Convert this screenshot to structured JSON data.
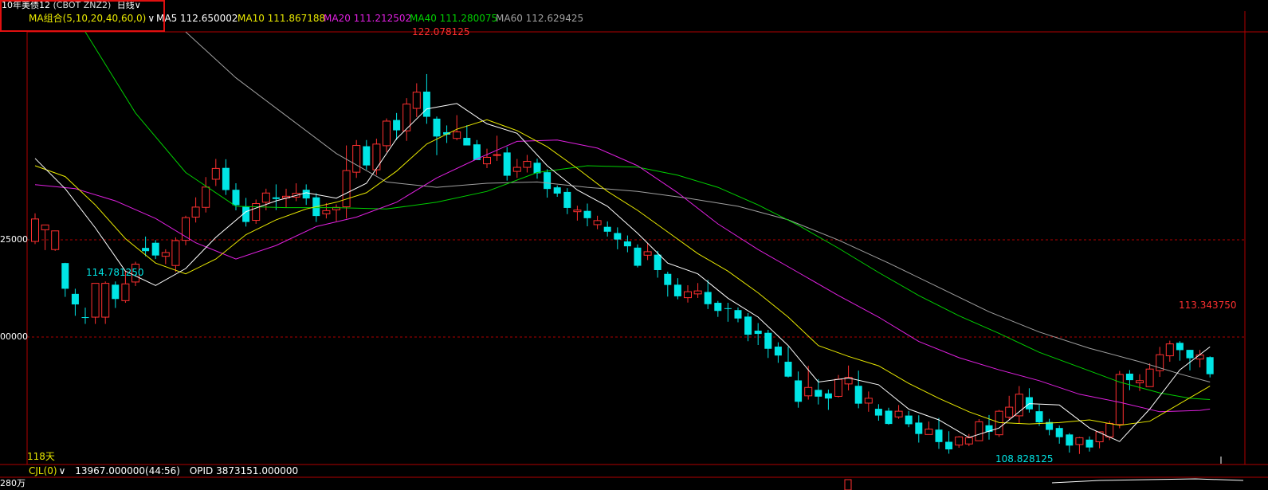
{
  "header": {
    "instrument": "10年美债12",
    "code": "(CBOT ZNZ2)",
    "period": "日线",
    "period_arrow": "∨"
  },
  "ma_bar": {
    "combo_label": "MA组合(5,10,20,40,60,0)",
    "combo_arrow": "∨",
    "items": [
      {
        "label": "MA5 112.650002",
        "color": "#ffffff"
      },
      {
        "label": "MA10 111.867188",
        "color": "#e8e800"
      },
      {
        "label": "MA20 111.212502",
        "color": "#e020e0"
      },
      {
        "label": "MA40 111.280075",
        "color": "#00d000"
      },
      {
        "label": "MA60 112.629425",
        "color": "#a0a0a0"
      }
    ]
  },
  "annotations": {
    "high": "122.078125",
    "low": "114.781250",
    "low2": "108.828125",
    "recent_high": "113.343750",
    "days": "118天"
  },
  "axis": {
    "tick_upper": "25000",
    "tick_lower": "00000",
    "vol_tick": "280万"
  },
  "volume_bar": {
    "label": "CJL(0)",
    "arrow": "∨",
    "value": "13967.000000(44:56)",
    "opid": "OPID 3873151.000000"
  },
  "colors": {
    "up": "#ff3030",
    "down": "#00e5e5",
    "grid": "#b00000",
    "ma5": "#ffffff",
    "ma10": "#e8e800",
    "ma20": "#e020e0",
    "ma40": "#00d000",
    "ma60": "#a0a0a0"
  },
  "chart_data": {
    "type": "candlestick",
    "ylim": [
      107.5,
      123.5
    ],
    "gridlines": [
      117.25,
      114.0
    ],
    "candles": [
      [
        115.75,
        116.58,
        116.79,
        115.65
      ],
      [
        116.18,
        116.36,
        116.37,
        115.43
      ],
      [
        115.45,
        116.14,
        116.15,
        115.4
      ],
      [
        114.95,
        114.0,
        114.96,
        113.7
      ],
      [
        113.81,
        113.42,
        114.0,
        113.0
      ],
      [
        112.95,
        112.92,
        113.3,
        112.7
      ],
      [
        112.95,
        114.2,
        114.2,
        112.7
      ],
      [
        112.95,
        114.2,
        114.27,
        112.7
      ],
      [
        114.15,
        113.62,
        114.27,
        113.29
      ],
      [
        113.56,
        114.18,
        114.64,
        113.48
      ],
      [
        114.25,
        114.91,
        115.0,
        114.1
      ],
      [
        115.51,
        115.39,
        115.93,
        115.2
      ],
      [
        115.7,
        115.23,
        115.8,
        115.1
      ],
      [
        115.2,
        115.34,
        115.46,
        114.91
      ],
      [
        114.86,
        115.78,
        115.9,
        114.62
      ],
      [
        115.79,
        116.63,
        116.7,
        115.61
      ],
      [
        116.65,
        117.02,
        117.38,
        116.45
      ],
      [
        117.01,
        117.76,
        118.13,
        116.82
      ],
      [
        118.05,
        118.45,
        118.8,
        117.8
      ],
      [
        118.47,
        117.65,
        118.79,
        117.47
      ],
      [
        117.66,
        117.09,
        117.9,
        116.9
      ],
      [
        117.04,
        116.47,
        117.36,
        116.3
      ],
      [
        116.53,
        117.15,
        117.3,
        116.4
      ],
      [
        117.2,
        117.54,
        117.7,
        116.9
      ],
      [
        117.38,
        117.32,
        117.86,
        116.91
      ],
      [
        117.36,
        117.42,
        117.7,
        117.0
      ],
      [
        117.39,
        117.53,
        117.9,
        117.24
      ],
      [
        117.66,
        117.34,
        117.86,
        117.1
      ],
      [
        117.38,
        116.69,
        117.53,
        116.47
      ],
      [
        116.77,
        116.89,
        117.17,
        116.6
      ],
      [
        116.92,
        117.01,
        117.12,
        116.5
      ],
      [
        117.03,
        118.37,
        119.3,
        116.6
      ],
      [
        118.31,
        119.3,
        119.5,
        118.1
      ],
      [
        119.27,
        118.56,
        119.5,
        118.4
      ],
      [
        118.4,
        119.35,
        119.55,
        118.21
      ],
      [
        119.29,
        120.2,
        120.3,
        119.05
      ],
      [
        120.24,
        119.86,
        120.5,
        119.5
      ],
      [
        119.84,
        120.83,
        121.05,
        119.47
      ],
      [
        120.67,
        121.27,
        121.6,
        120.35
      ],
      [
        121.29,
        120.36,
        121.94,
        120.1
      ],
      [
        120.29,
        119.63,
        120.37,
        118.94
      ],
      [
        119.79,
        119.7,
        120.04,
        119.39
      ],
      [
        119.56,
        119.8,
        120.42,
        119.49
      ],
      [
        119.58,
        119.3,
        120.05,
        119.35
      ],
      [
        119.34,
        118.76,
        119.5,
        118.78
      ],
      [
        118.62,
        118.86,
        119.18,
        118.46
      ],
      [
        118.93,
        118.96,
        119.66,
        118.73
      ],
      [
        119.04,
        118.18,
        119.24,
        118.0
      ],
      [
        118.34,
        118.49,
        118.8,
        118.1
      ],
      [
        118.49,
        118.71,
        118.95,
        118.3
      ],
      [
        118.66,
        118.27,
        118.81,
        118.07
      ],
      [
        118.31,
        117.69,
        118.42,
        117.37
      ],
      [
        117.75,
        117.52,
        117.82,
        117.4
      ],
      [
        117.58,
        116.99,
        117.72,
        116.76
      ],
      [
        116.85,
        116.91,
        117.07,
        116.52
      ],
      [
        116.88,
        116.61,
        117.15,
        116.31
      ],
      [
        116.37,
        116.52,
        116.7,
        116.2
      ],
      [
        116.29,
        116.11,
        116.49,
        115.93
      ],
      [
        116.06,
        115.82,
        116.27,
        115.46
      ],
      [
        115.75,
        115.57,
        115.97,
        115.35
      ],
      [
        115.52,
        114.85,
        115.64,
        114.79
      ],
      [
        115.24,
        115.37,
        115.68,
        115.06
      ],
      [
        115.26,
        114.69,
        115.4,
        114.41
      ],
      [
        114.55,
        114.14,
        114.63,
        113.71
      ],
      [
        114.15,
        113.72,
        114.39,
        113.61
      ],
      [
        113.67,
        113.89,
        114.13,
        113.49
      ],
      [
        113.81,
        113.92,
        114.21,
        113.66
      ],
      [
        113.88,
        113.43,
        114.33,
        113.25
      ],
      [
        113.48,
        113.18,
        113.55,
        112.96
      ],
      [
        113.28,
        113.26,
        113.48,
        112.78
      ],
      [
        113.21,
        112.9,
        113.31,
        112.76
      ],
      [
        112.97,
        112.3,
        113.1,
        112.06
      ],
      [
        112.45,
        112.33,
        112.73,
        111.92
      ],
      [
        112.37,
        111.78,
        112.48,
        111.44
      ],
      [
        111.86,
        111.53,
        112.02,
        111.26
      ],
      [
        111.3,
        110.75,
        111.86,
        110.72
      ],
      [
        110.61,
        109.82,
        110.94,
        109.6
      ],
      [
        110.04,
        110.35,
        111.15,
        109.9
      ],
      [
        110.26,
        110.01,
        110.66,
        109.72
      ],
      [
        110.13,
        109.94,
        110.27,
        109.52
      ],
      [
        110.02,
        110.65,
        110.81,
        109.98
      ],
      [
        110.48,
        110.72,
        111.16,
        110.24
      ],
      [
        110.41,
        109.75,
        110.97,
        109.58
      ],
      [
        109.77,
        109.95,
        110.2,
        109.45
      ],
      [
        109.56,
        109.31,
        109.73,
        109.12
      ],
      [
        109.49,
        109.0,
        109.6,
        108.97
      ],
      [
        109.26,
        109.47,
        109.7,
        109.19
      ],
      [
        109.31,
        108.99,
        109.48,
        108.88
      ],
      [
        109.05,
        108.63,
        109.32,
        108.31
      ],
      [
        108.61,
        108.81,
        109.09,
        108.63
      ],
      [
        108.79,
        108.33,
        109.22,
        108.08
      ],
      [
        108.34,
        108.06,
        108.73,
        107.9
      ],
      [
        108.22,
        108.52,
        108.55,
        108.12
      ],
      [
        108.26,
        108.49,
        108.63,
        108.18
      ],
      [
        108.38,
        109.08,
        109.18,
        108.47
      ],
      [
        108.95,
        108.71,
        109.33,
        108.42
      ],
      [
        108.6,
        109.47,
        109.52,
        108.52
      ],
      [
        109.25,
        109.62,
        110.04,
        109.16
      ],
      [
        109.3,
        110.1,
        110.4,
        109.03
      ],
      [
        109.99,
        109.54,
        110.32,
        109.42
      ],
      [
        109.47,
        109.06,
        109.71,
        108.93
      ],
      [
        109.07,
        108.78,
        109.19,
        108.58
      ],
      [
        108.85,
        108.51,
        108.94,
        108.27
      ],
      [
        108.61,
        108.2,
        108.66,
        107.94
      ],
      [
        108.24,
        108.49,
        108.52,
        107.89
      ],
      [
        108.42,
        108.13,
        108.54,
        107.98
      ],
      [
        108.34,
        108.71,
        108.72,
        108.1
      ],
      [
        108.52,
        109.02,
        109.11,
        108.4
      ],
      [
        108.98,
        110.83,
        110.96,
        108.84
      ],
      [
        110.86,
        110.62,
        110.99,
        110.25
      ],
      [
        110.52,
        110.6,
        110.84,
        110.22
      ],
      [
        110.38,
        111.03,
        111.24,
        110.4
      ],
      [
        110.97,
        111.56,
        111.85,
        110.74
      ],
      [
        111.52,
        111.96,
        112.08,
        111.3
      ],
      [
        112.0,
        111.73,
        112.06,
        111.34
      ],
      [
        111.74,
        111.43,
        111.74,
        110.98
      ],
      [
        111.4,
        111.55,
        111.74,
        111.09
      ],
      [
        111.47,
        110.84,
        111.5,
        110.72
      ]
    ],
    "ma5": [
      [
        0,
        118.82
      ],
      [
        3,
        117.7
      ],
      [
        6,
        116.25
      ],
      [
        9,
        114.65
      ],
      [
        12,
        114.12
      ],
      [
        15,
        114.75
      ],
      [
        18,
        115.9
      ],
      [
        21,
        116.85
      ],
      [
        24,
        117.25
      ],
      [
        27,
        117.55
      ],
      [
        30,
        117.35
      ],
      [
        33,
        117.9
      ],
      [
        36,
        119.55
      ],
      [
        39,
        120.65
      ],
      [
        42,
        120.85
      ],
      [
        45,
        120.1
      ],
      [
        48,
        119.75
      ],
      [
        51,
        118.55
      ],
      [
        54,
        117.65
      ],
      [
        57,
        117.05
      ],
      [
        60,
        116.05
      ],
      [
        63,
        114.95
      ],
      [
        66,
        114.55
      ],
      [
        69,
        113.65
      ],
      [
        72,
        112.95
      ],
      [
        75,
        111.9
      ],
      [
        78,
        110.55
      ],
      [
        81,
        110.7
      ],
      [
        84,
        110.45
      ],
      [
        87,
        109.55
      ],
      [
        90,
        109.15
      ],
      [
        93,
        108.5
      ],
      [
        96,
        108.85
      ],
      [
        99,
        109.75
      ],
      [
        102,
        109.7
      ],
      [
        105,
        108.85
      ],
      [
        108,
        108.35
      ],
      [
        111,
        109.55
      ],
      [
        114,
        111.0
      ],
      [
        117,
        111.85
      ]
    ],
    "ma10": [
      [
        0,
        118.55
      ],
      [
        3,
        118.15
      ],
      [
        6,
        117.1
      ],
      [
        9,
        115.85
      ],
      [
        12,
        114.95
      ],
      [
        15,
        114.55
      ],
      [
        18,
        115.1
      ],
      [
        21,
        116.0
      ],
      [
        24,
        116.55
      ],
      [
        27,
        116.95
      ],
      [
        30,
        117.2
      ],
      [
        33,
        117.55
      ],
      [
        36,
        118.35
      ],
      [
        39,
        119.35
      ],
      [
        42,
        119.9
      ],
      [
        45,
        120.25
      ],
      [
        48,
        119.85
      ],
      [
        51,
        119.25
      ],
      [
        54,
        118.45
      ],
      [
        57,
        117.6
      ],
      [
        60,
        116.9
      ],
      [
        63,
        116.1
      ],
      [
        66,
        115.3
      ],
      [
        69,
        114.65
      ],
      [
        72,
        113.85
      ],
      [
        75,
        112.95
      ],
      [
        78,
        111.9
      ],
      [
        81,
        111.5
      ],
      [
        84,
        111.15
      ],
      [
        87,
        110.5
      ],
      [
        90,
        109.95
      ],
      [
        93,
        109.45
      ],
      [
        96,
        109.05
      ],
      [
        99,
        109.0
      ],
      [
        102,
        109.05
      ],
      [
        105,
        109.15
      ],
      [
        108,
        108.95
      ],
      [
        111,
        109.1
      ],
      [
        114,
        109.75
      ],
      [
        117,
        110.4
      ]
    ],
    "ma20": [
      [
        0,
        117.85
      ],
      [
        4,
        117.7
      ],
      [
        8,
        117.25
      ],
      [
        12,
        116.6
      ],
      [
        16,
        115.7
      ],
      [
        20,
        115.1
      ],
      [
        24,
        115.6
      ],
      [
        28,
        116.3
      ],
      [
        32,
        116.65
      ],
      [
        36,
        117.2
      ],
      [
        40,
        118.1
      ],
      [
        44,
        118.8
      ],
      [
        48,
        119.45
      ],
      [
        52,
        119.5
      ],
      [
        56,
        119.2
      ],
      [
        60,
        118.55
      ],
      [
        64,
        117.55
      ],
      [
        68,
        116.4
      ],
      [
        72,
        115.45
      ],
      [
        76,
        114.6
      ],
      [
        80,
        113.75
      ],
      [
        84,
        112.95
      ],
      [
        88,
        112.05
      ],
      [
        92,
        111.45
      ],
      [
        96,
        111.0
      ],
      [
        100,
        110.6
      ],
      [
        104,
        110.1
      ],
      [
        108,
        109.8
      ],
      [
        112,
        109.45
      ],
      [
        116,
        109.5
      ],
      [
        117,
        109.55
      ]
    ],
    "ma40": [
      [
        5,
        123.5
      ],
      [
        10,
        120.5
      ],
      [
        15,
        118.3
      ],
      [
        20,
        117.05
      ],
      [
        25,
        117.0
      ],
      [
        30,
        117.0
      ],
      [
        35,
        116.95
      ],
      [
        40,
        117.2
      ],
      [
        45,
        117.6
      ],
      [
        50,
        118.3
      ],
      [
        55,
        118.55
      ],
      [
        60,
        118.5
      ],
      [
        64,
        118.2
      ],
      [
        68,
        117.75
      ],
      [
        72,
        117.1
      ],
      [
        76,
        116.35
      ],
      [
        80,
        115.5
      ],
      [
        84,
        114.6
      ],
      [
        88,
        113.75
      ],
      [
        92,
        113.0
      ],
      [
        96,
        112.35
      ],
      [
        100,
        111.65
      ],
      [
        104,
        111.1
      ],
      [
        108,
        110.55
      ],
      [
        112,
        110.15
      ],
      [
        115,
        109.95
      ],
      [
        117,
        109.9
      ]
    ],
    "ma60": [
      [
        15,
        123.5
      ],
      [
        20,
        121.8
      ],
      [
        25,
        120.4
      ],
      [
        30,
        119.0
      ],
      [
        35,
        117.95
      ],
      [
        40,
        117.75
      ],
      [
        45,
        117.9
      ],
      [
        50,
        117.95
      ],
      [
        55,
        117.75
      ],
      [
        60,
        117.6
      ],
      [
        65,
        117.35
      ],
      [
        70,
        117.05
      ],
      [
        75,
        116.55
      ],
      [
        80,
        115.8
      ],
      [
        85,
        114.95
      ],
      [
        90,
        114.05
      ],
      [
        95,
        113.15
      ],
      [
        100,
        112.4
      ],
      [
        105,
        111.8
      ],
      [
        110,
        111.3
      ],
      [
        114,
        110.85
      ],
      [
        117,
        110.55
      ]
    ]
  }
}
